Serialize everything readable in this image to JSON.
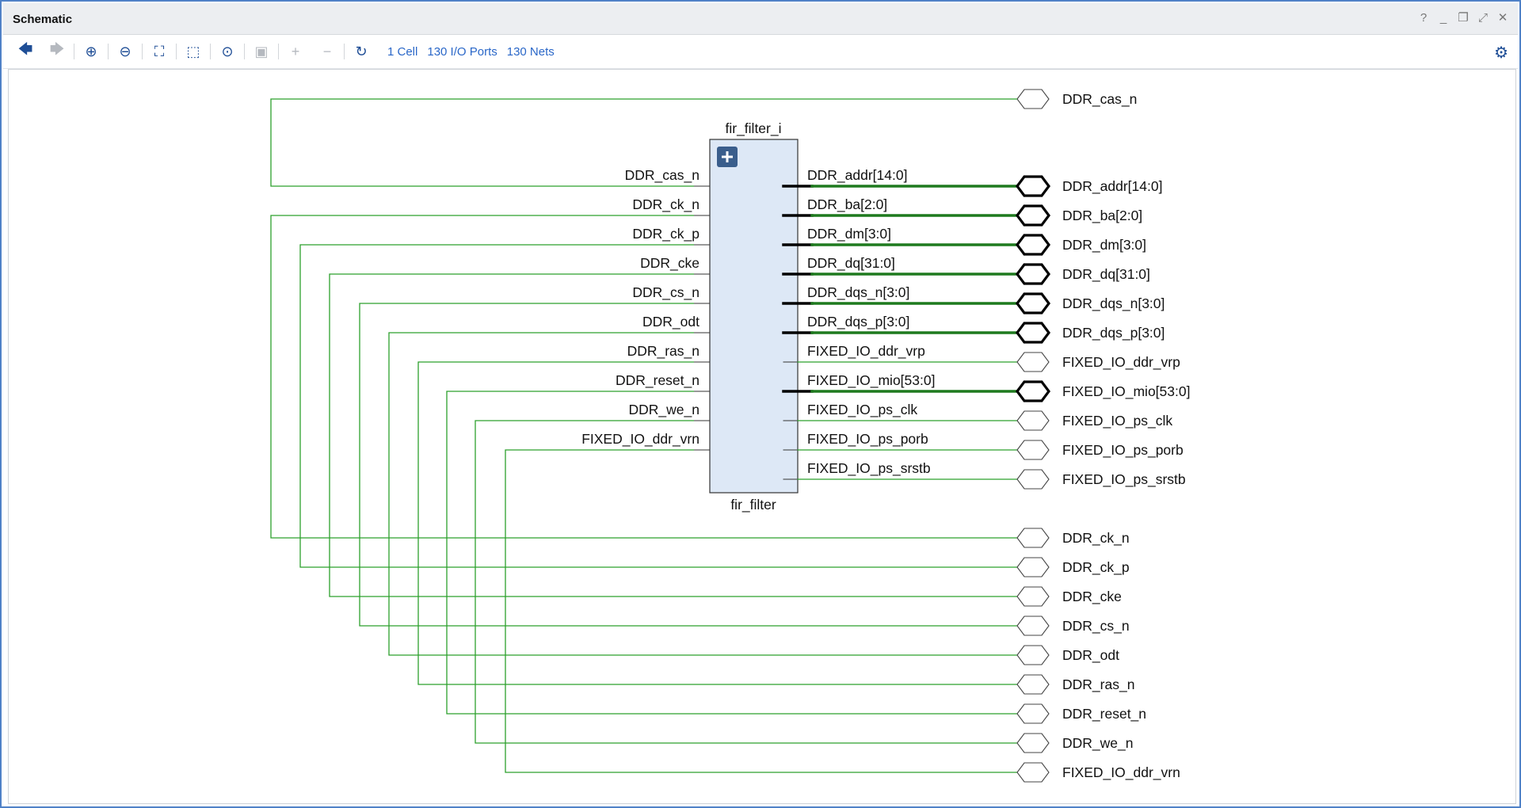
{
  "window": {
    "title": "Schematic"
  },
  "window_controls": [
    "?",
    "_",
    "❐",
    "⤢",
    "✕"
  ],
  "toolbar": {
    "buttons": [
      {
        "name": "back-button",
        "icon": "arrow-left-icon",
        "glyph": "🡄",
        "disabled": false
      },
      {
        "name": "forward-button",
        "icon": "arrow-right-icon",
        "glyph": "🡆",
        "disabled": true
      },
      {
        "name": "zoom-in-button",
        "icon": "zoom-in-icon",
        "glyph": "⊕",
        "disabled": false
      },
      {
        "name": "zoom-out-button",
        "icon": "zoom-out-icon",
        "glyph": "⊖",
        "disabled": false
      },
      {
        "name": "zoom-fit-button",
        "icon": "fit-icon",
        "glyph": "⛶",
        "disabled": false
      },
      {
        "name": "zoom-area-button",
        "icon": "zoom-area-icon",
        "glyph": "⬚",
        "disabled": false
      },
      {
        "name": "autofit-selection-button",
        "icon": "crosshair-icon",
        "glyph": "⊙",
        "disabled": false
      },
      {
        "name": "regenerate-button",
        "icon": "chip-icon",
        "glyph": "▣",
        "disabled": true
      },
      {
        "name": "expand-button",
        "icon": "plus-icon",
        "glyph": "+",
        "disabled": true
      },
      {
        "name": "collapse-button",
        "icon": "minus-icon",
        "glyph": "−",
        "disabled": true
      },
      {
        "name": "reload-button",
        "icon": "refresh-icon",
        "glyph": "↻",
        "disabled": false
      }
    ],
    "cells_link": "1 Cell",
    "ports_link": "130 I/O Ports",
    "nets_link": "130 Nets",
    "settings_icon": "gear-icon"
  },
  "schematic": {
    "instance_name": "fir_filter_i",
    "cell_type": "fir_filter",
    "expand_icon": "plus-icon",
    "net_color": "#2ca02c",
    "bus_color": "#1e7a1e",
    "left_pins": [
      "DDR_cas_n",
      "DDR_ck_n",
      "DDR_ck_p",
      "DDR_cke",
      "DDR_cs_n",
      "DDR_odt",
      "DDR_ras_n",
      "DDR_reset_n",
      "DDR_we_n",
      "FIXED_IO_ddr_vrn"
    ],
    "right_pins": [
      {
        "name": "DDR_addr[14:0]",
        "bus": true
      },
      {
        "name": "DDR_ba[2:0]",
        "bus": true
      },
      {
        "name": "DDR_dm[3:0]",
        "bus": true
      },
      {
        "name": "DDR_dq[31:0]",
        "bus": true
      },
      {
        "name": "DDR_dqs_n[3:0]",
        "bus": true
      },
      {
        "name": "DDR_dqs_p[3:0]",
        "bus": true
      },
      {
        "name": "FIXED_IO_ddr_vrp",
        "bus": false
      },
      {
        "name": "FIXED_IO_mio[53:0]",
        "bus": true
      },
      {
        "name": "FIXED_IO_ps_clk",
        "bus": false
      },
      {
        "name": "FIXED_IO_ps_porb",
        "bus": false
      },
      {
        "name": "FIXED_IO_ps_srstb",
        "bus": false
      }
    ],
    "top_port": "DDR_cas_n",
    "right_ports": [
      "DDR_addr[14:0]",
      "DDR_ba[2:0]",
      "DDR_dm[3:0]",
      "DDR_dq[31:0]",
      "DDR_dqs_n[3:0]",
      "DDR_dqs_p[3:0]",
      "FIXED_IO_ddr_vrp",
      "FIXED_IO_mio[53:0]",
      "FIXED_IO_ps_clk",
      "FIXED_IO_ps_porb",
      "FIXED_IO_ps_srstb"
    ],
    "bottom_ports": [
      "DDR_ck_n",
      "DDR_ck_p",
      "DDR_cke",
      "DDR_cs_n",
      "DDR_odt",
      "DDR_ras_n",
      "DDR_reset_n",
      "DDR_we_n",
      "FIXED_IO_ddr_vrn"
    ]
  }
}
